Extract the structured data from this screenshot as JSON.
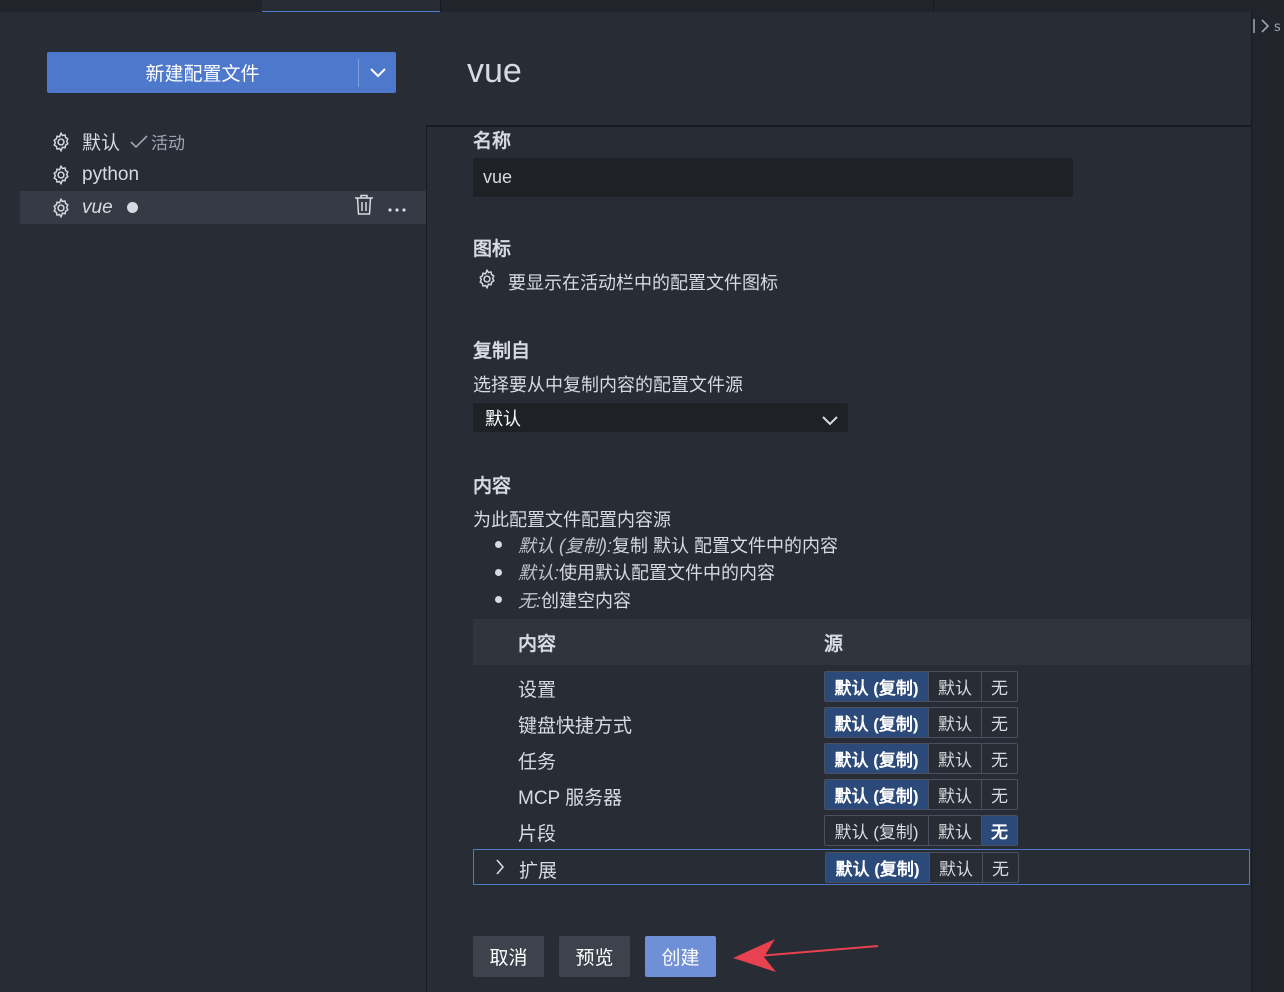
{
  "sidebar": {
    "new_profile_button": "新建配置文件",
    "profiles": [
      {
        "name": "默认",
        "active_label": "活动"
      },
      {
        "name": "python"
      },
      {
        "name": "vue"
      }
    ]
  },
  "main": {
    "title": "vue",
    "name_field": {
      "label": "名称",
      "value": "vue"
    },
    "icon_field": {
      "label": "图标",
      "description": "要显示在活动栏中的配置文件图标"
    },
    "copy_from": {
      "label": "复制自",
      "description": "选择要从中复制内容的配置文件源",
      "selected": "默认"
    },
    "contents": {
      "label": "内容",
      "description": "为此配置文件配置内容源",
      "bullets": [
        {
          "em": "默认 (复制):",
          "text": " 复制 默认 配置文件中的内容"
        },
        {
          "em": "默认:",
          "text": " 使用默认配置文件中的内容"
        },
        {
          "em": "无:",
          "text": " 创建空内容"
        }
      ],
      "table": {
        "col_content": "内容",
        "col_source": "源",
        "options": [
          "默认 (复制)",
          "默认",
          "无"
        ],
        "rows": [
          {
            "label": "设置",
            "selected": 0
          },
          {
            "label": "键盘快捷方式",
            "selected": 0
          },
          {
            "label": "任务",
            "selected": 0
          },
          {
            "label": "MCP 服务器",
            "selected": 0
          },
          {
            "label": "片段",
            "selected": 2
          },
          {
            "label": "扩展",
            "selected": 0
          }
        ]
      }
    },
    "buttons": {
      "cancel": "取消",
      "preview": "预览",
      "create": "创建"
    }
  },
  "colors": {
    "accent": "#4d78cc",
    "annotation_arrow": "#e8414f"
  }
}
